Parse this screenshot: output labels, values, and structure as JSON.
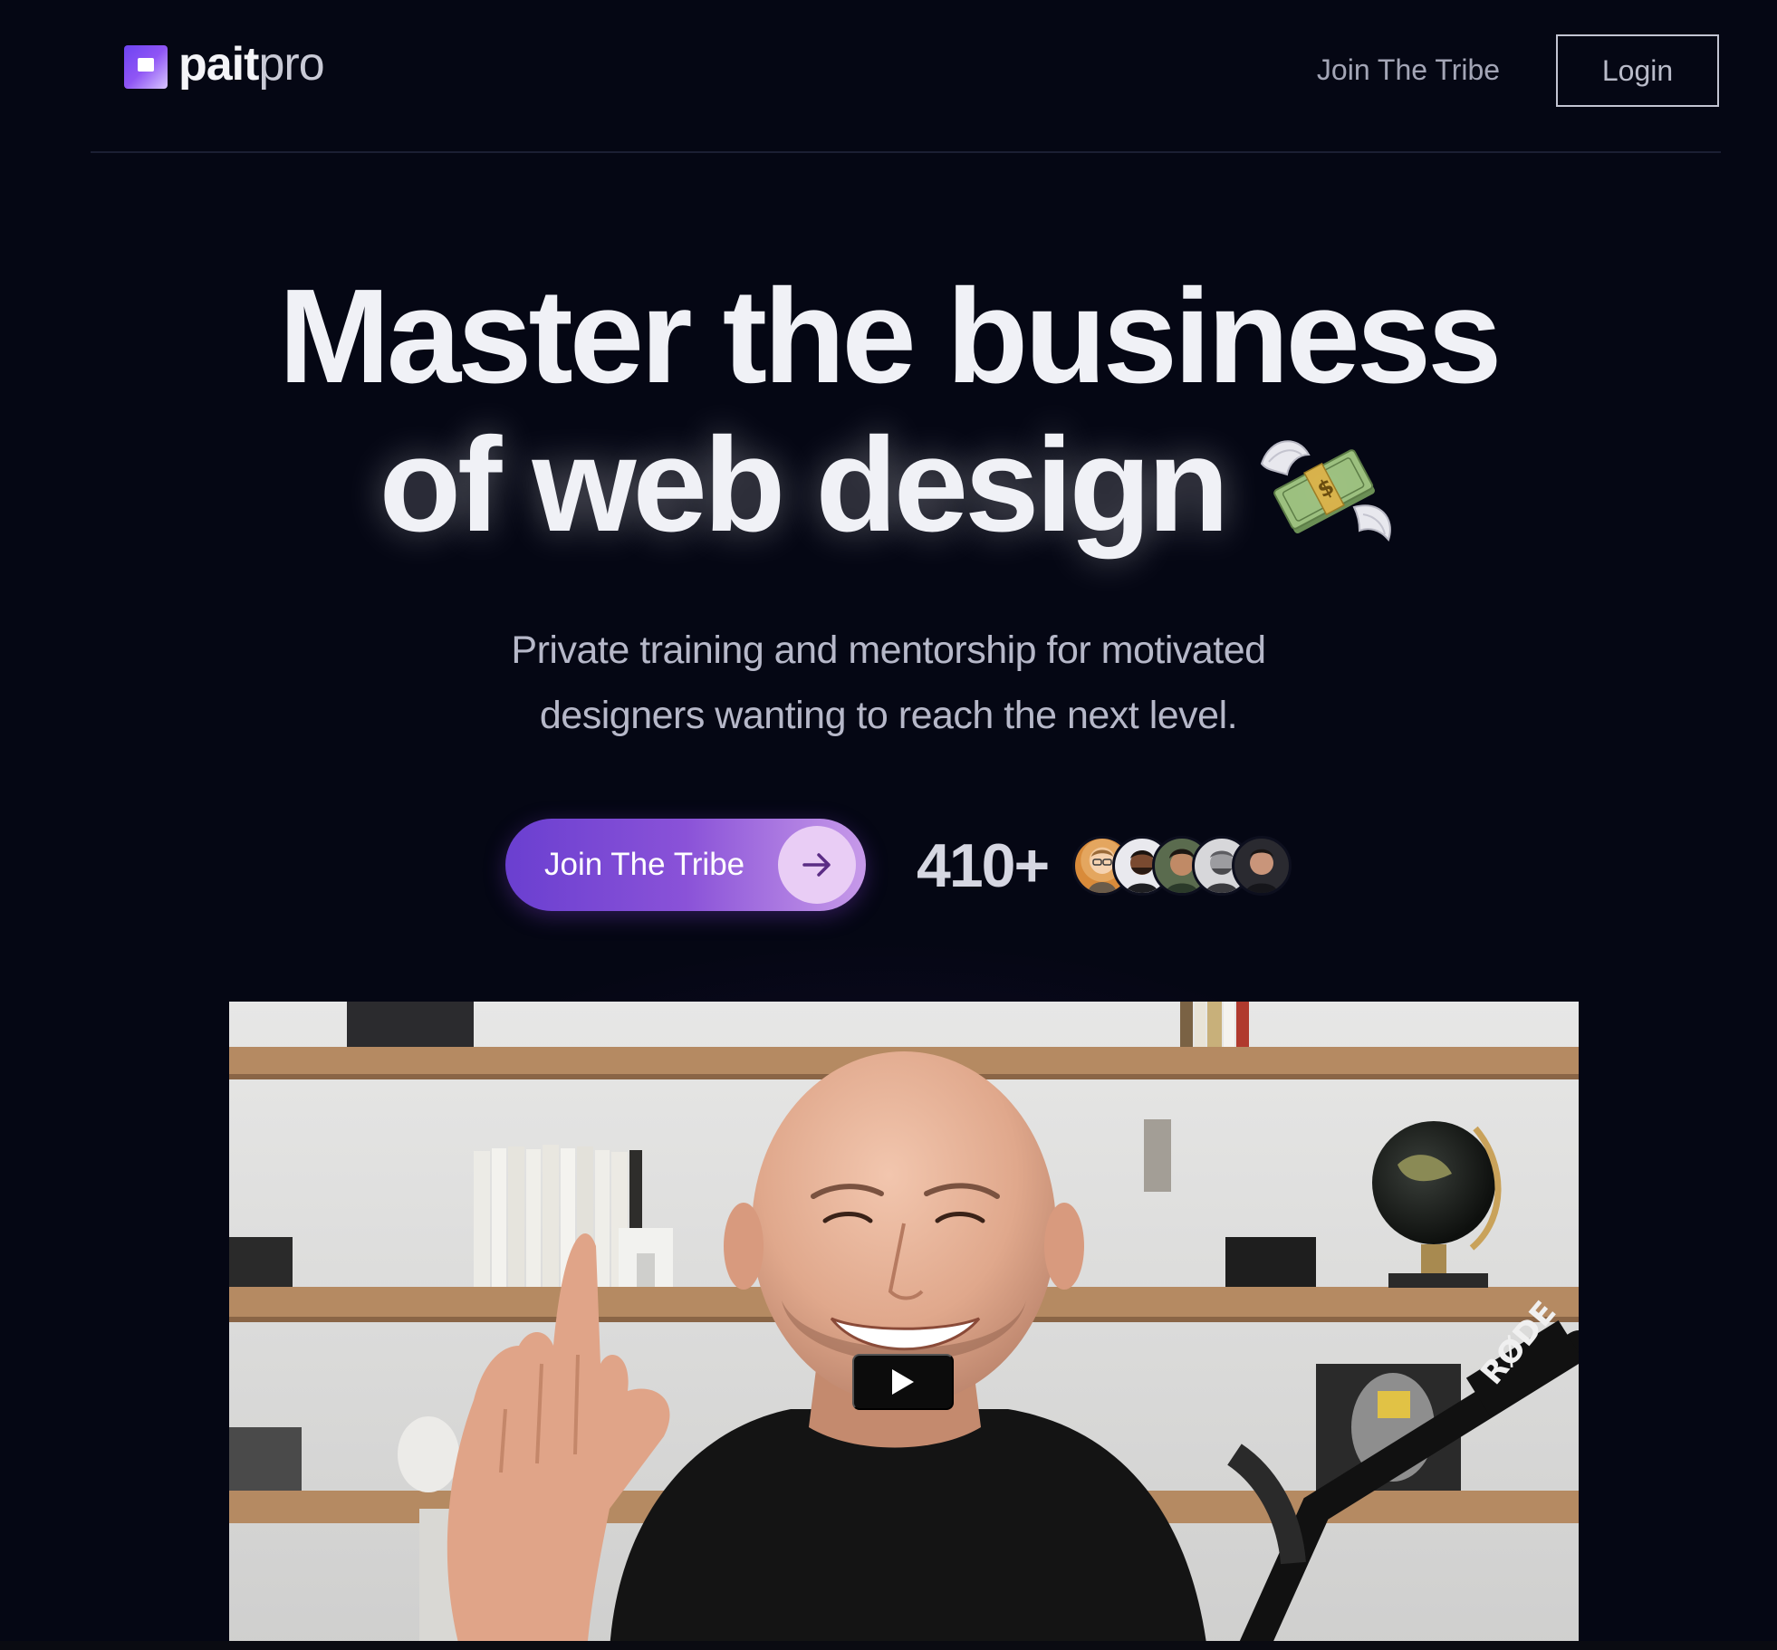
{
  "header": {
    "logo": {
      "bold": "pait",
      "light": "pro"
    },
    "nav_link": "Join The Tribe",
    "login": "Login"
  },
  "hero": {
    "headline_line1": "Master the business",
    "headline_line2": "of web design",
    "headline_icon": "money-with-wings-icon",
    "subtitle_line1": "Private training and mentorship for motivated",
    "subtitle_line2": "designers wanting to reach the next level.",
    "cta_label": "Join The Tribe",
    "cta_icon": "arrow-right-icon",
    "member_count": "410+"
  },
  "video": {
    "play_icon": "play-icon",
    "mic_brand": "RØDE"
  },
  "colors": {
    "background": "#050714",
    "accent_start": "#6a3fd0",
    "accent_end": "#c79ae9",
    "text": "#f0f1f6",
    "muted": "#b6b8c9"
  }
}
